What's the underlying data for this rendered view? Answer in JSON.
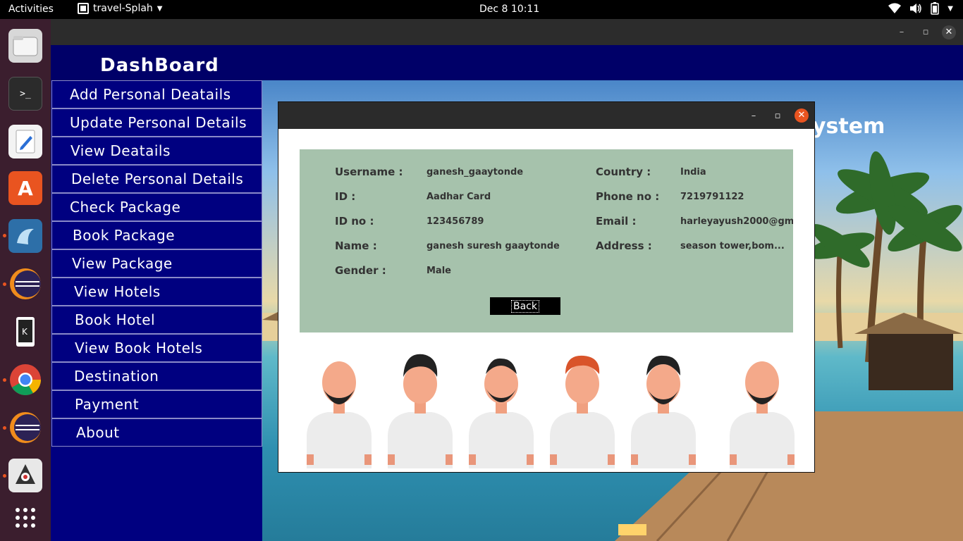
{
  "topbar": {
    "activities": "Activities",
    "app_name": "travel-Splah",
    "clock": "Dec 8  10:11"
  },
  "dock": {
    "items": [
      "files-icon",
      "terminal-icon",
      "text-editor-icon",
      "software-center-icon",
      "mysql-workbench-icon",
      "eclipse-icon",
      "kde-connect-icon",
      "chrome-icon",
      "eclipse-icon",
      "java-icon",
      "app-grid-icon"
    ]
  },
  "window": {
    "header_title": "DashBoard"
  },
  "sidebar": {
    "items": [
      {
        "label": "Add Personal Deatails"
      },
      {
        "label": "Update Personal Details"
      },
      {
        "label": "View Deatails"
      },
      {
        "label": "Delete Personal Details"
      },
      {
        "label": "Check Package"
      },
      {
        "label": "Book Package"
      },
      {
        "label": "View Package"
      },
      {
        "label": "View Hotels"
      },
      {
        "label": "Book Hotel"
      },
      {
        "label": "View Book Hotels"
      },
      {
        "label": "Destination"
      },
      {
        "label": "Payment"
      },
      {
        "label": "About"
      }
    ]
  },
  "background": {
    "partial_title": "ystem"
  },
  "details": {
    "username_label": "Username :",
    "username": "ganesh_gaaytonde",
    "id_label": "ID :",
    "id": "Aadhar Card",
    "id_no_label": "ID no :",
    "id_no": "123456789",
    "name_label": "Name :",
    "name": "ganesh suresh gaaytonde",
    "gender_label": "Gender :",
    "gender": "Male",
    "country_label": "Country :",
    "country": "India",
    "phone_label": "Phone no :",
    "phone": "7219791122",
    "email_label": "Email :",
    "email": "harleyayush2000@gm...",
    "address_label": "Address :",
    "address": "season tower,bom...",
    "back_label": "Back"
  },
  "colors": {
    "sidebar_bg": "#000080",
    "header_bg": "#000068",
    "panel_bg": "#a6c2ac",
    "accent_orange": "#e95420"
  }
}
